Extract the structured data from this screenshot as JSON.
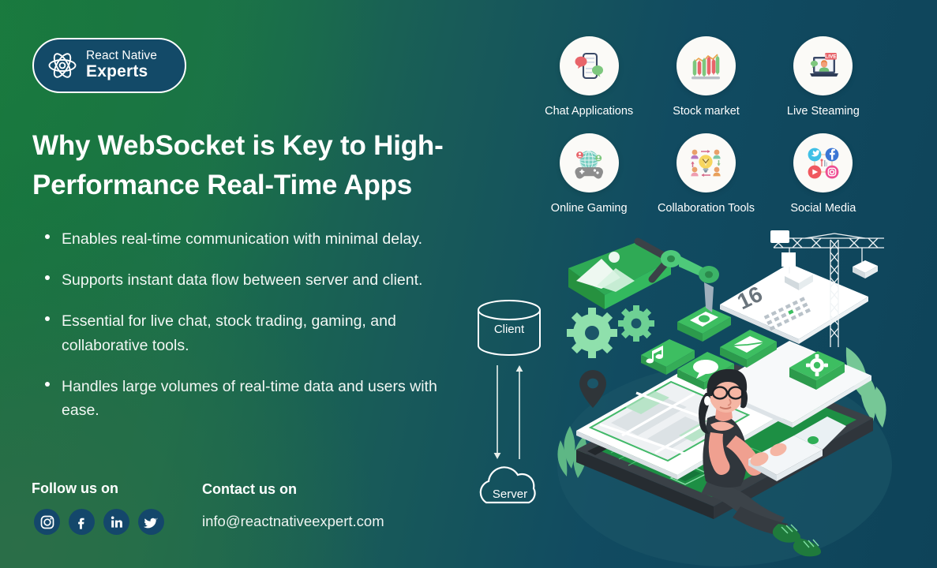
{
  "brand": {
    "logo_icon": "atom-icon",
    "name_line1": "React Native",
    "name_line2": "Experts"
  },
  "headline": "Why WebSocket is Key to High-Performance Real-Time Apps",
  "bullets": [
    "Enables real-time communication with minimal delay.",
    "Supports instant data flow between server and client.",
    "Essential for live chat, stock trading, gaming, and collaborative tools.",
    "Handles large volumes of real-time data and users with ease."
  ],
  "features": [
    {
      "label": "Chat Applications",
      "icon": "chat-phone-icon"
    },
    {
      "label": "Stock market",
      "icon": "candlestick-chart-icon"
    },
    {
      "label": "Live Steaming",
      "icon": "live-laptop-icon"
    },
    {
      "label": "Online Gaming",
      "icon": "globe-gamepad-icon"
    },
    {
      "label": "Collaboration Tools",
      "icon": "lightbulb-team-icon"
    },
    {
      "label": "Social Media",
      "icon": "social-network-icon"
    }
  ],
  "diagram": {
    "client_label": "Client",
    "server_label": "Server",
    "client_shape": "cylinder-database-icon",
    "server_shape": "cloud-icon",
    "arrow_down": "arrow-down-icon",
    "arrow_up": "arrow-up-icon"
  },
  "footer": {
    "follow_heading": "Follow us on",
    "contact_heading": "Contact us on",
    "email": "info@reactnativeexpert.com",
    "socials": [
      {
        "name": "instagram-icon"
      },
      {
        "name": "facebook-icon"
      },
      {
        "name": "linkedin-icon"
      },
      {
        "name": "twitter-icon"
      }
    ]
  },
  "illustration": {
    "name": "isometric-mobile-development-illustration",
    "calendar_day": "16"
  },
  "colors": {
    "gradient_start": "#16713c",
    "gradient_end": "#0e4359",
    "logo_pill": "#134a68",
    "accent_green": "#2fb457",
    "text_light": "#ffffff"
  }
}
